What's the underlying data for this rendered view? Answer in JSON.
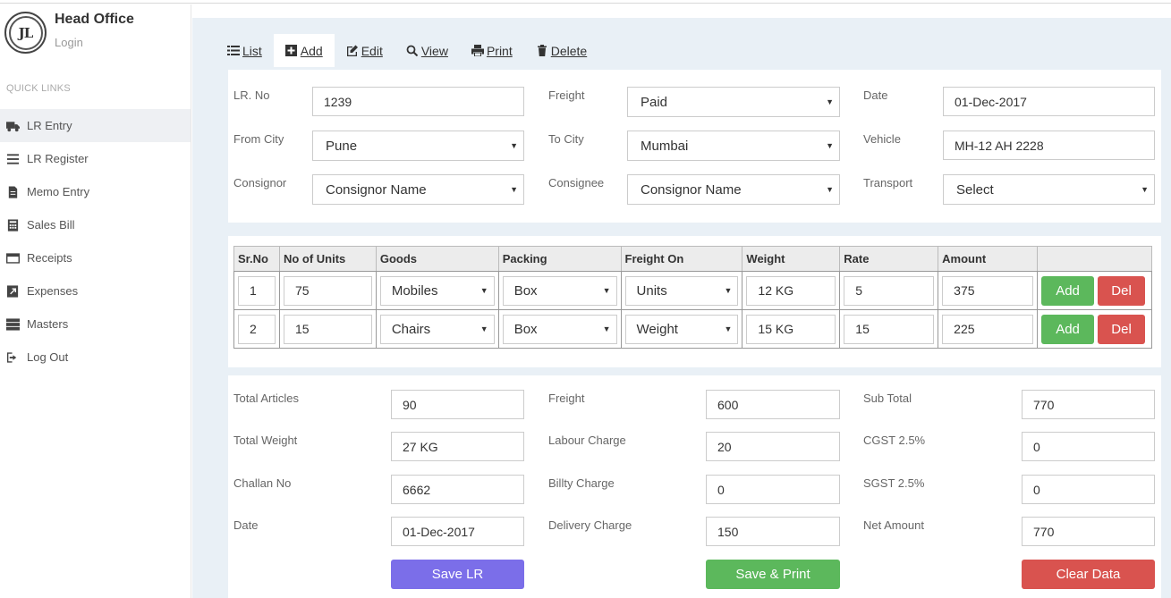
{
  "sidebar": {
    "logo_text": "JL",
    "title": "Head Office",
    "subtitle": "Login",
    "quick_links": "QUICK LINKS",
    "items": [
      {
        "label": "LR Entry",
        "icon": "truck-icon"
      },
      {
        "label": "LR Register",
        "icon": "list-icon"
      },
      {
        "label": "Memo Entry",
        "icon": "file-icon"
      },
      {
        "label": "Sales Bill",
        "icon": "calculator-icon"
      },
      {
        "label": "Receipts",
        "icon": "credit-card-icon"
      },
      {
        "label": "Expenses",
        "icon": "external-link-icon"
      },
      {
        "label": "Masters",
        "icon": "server-icon"
      },
      {
        "label": "Log Out",
        "icon": "logout-icon"
      }
    ]
  },
  "tabs": [
    {
      "label": "List",
      "icon": "list-icon"
    },
    {
      "label": "Add",
      "icon": "plus-square-icon"
    },
    {
      "label": "Edit",
      "icon": "edit-icon"
    },
    {
      "label": "View",
      "icon": "search-icon"
    },
    {
      "label": "Print",
      "icon": "print-icon"
    },
    {
      "label": "Delete",
      "icon": "trash-icon"
    }
  ],
  "header_form": {
    "lr_no_label": "LR. No",
    "lr_no": "1239",
    "freight_label": "Freight",
    "freight": "Paid",
    "date_label": "Date",
    "date": "01-Dec-2017",
    "from_city_label": "From City",
    "from_city": "Pune",
    "to_city_label": "To City",
    "to_city": "Mumbai",
    "vehicle_label": "Vehicle",
    "vehicle": "MH-12 AH 2228",
    "consignor_label": "Consignor",
    "consignor": "Consignor Name",
    "consignee_label": "Consignee",
    "consignee": "Consignor Name",
    "transport_label": "Transport",
    "transport": "Select"
  },
  "items_table": {
    "headers": [
      "Sr.No",
      "No of Units",
      "Goods",
      "Packing",
      "Freight On",
      "Weight",
      "Rate",
      "Amount",
      ""
    ],
    "rows": [
      {
        "sr": "1",
        "units": "75",
        "goods": "Mobiles",
        "packing": "Box",
        "freight_on": "Units",
        "weight": "12 KG",
        "rate": "5",
        "amount": "375"
      },
      {
        "sr": "2",
        "units": "15",
        "goods": "Chairs",
        "packing": "Box",
        "freight_on": "Weight",
        "weight": "15 KG",
        "rate": "15",
        "amount": "225"
      }
    ],
    "add_label": "Add",
    "del_label": "Del"
  },
  "totals": {
    "total_articles_label": "Total Articles",
    "total_articles": "90",
    "total_weight_label": "Total Weight",
    "total_weight": "27 KG",
    "challan_no_label": "Challan No",
    "challan_no": "6662",
    "date_label": "Date",
    "date": "01-Dec-2017",
    "freight_label": "Freight",
    "freight": "600",
    "labour_label": "Labour Charge",
    "labour": "20",
    "billty_label": "Billty Charge",
    "billty": "0",
    "delivery_label": "Delivery Charge",
    "delivery": "150",
    "subtotal_label": "Sub Total",
    "subtotal": "770",
    "cgst_label": "CGST 2.5%",
    "cgst": "0",
    "sgst_label": "SGST 2.5%",
    "sgst": "0",
    "net_label": "Net Amount",
    "net": "770"
  },
  "actions": {
    "save": "Save LR",
    "save_print": "Save & Print",
    "clear": "Clear Data"
  },
  "colors": {
    "save": "#7b6ee9",
    "green": "#5cb85c",
    "red": "#d9534f",
    "panel_bg": "#e9f0f6"
  }
}
